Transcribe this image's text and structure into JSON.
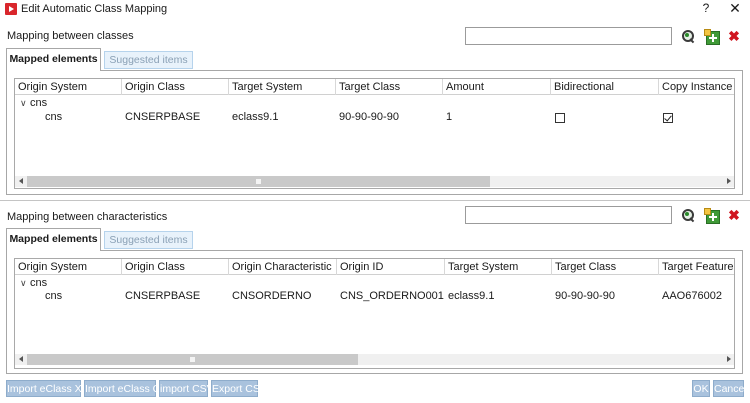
{
  "window": {
    "title": "Edit Automatic Class Mapping",
    "help_label": "?",
    "close_label": "✕"
  },
  "classes_section": {
    "label": "Mapping between classes",
    "search_value": "",
    "tabs": [
      {
        "label": "Mapped elements",
        "active": true
      },
      {
        "label": "Suggested items",
        "active": false
      }
    ],
    "columns": [
      "Origin System",
      "Origin Class",
      "Target System",
      "Target Class",
      "Amount",
      "Bidirectional",
      "Copy Instance"
    ],
    "group": {
      "label": "cns",
      "expanded": true
    },
    "rows": [
      {
        "origin_system": "cns",
        "origin_class": "CNSERPBASE",
        "target_system": "eclass9.1",
        "target_class": "90-90-90-90",
        "amount": "1",
        "bidirectional": false,
        "copy_instance": true
      }
    ]
  },
  "characteristics_section": {
    "label": "Mapping between characteristics",
    "search_value": "",
    "tabs": [
      {
        "label": "Mapped elements",
        "active": true
      },
      {
        "label": "Suggested items",
        "active": false
      }
    ],
    "columns": [
      "Origin System",
      "Origin Class",
      "Origin Characteristic",
      "Origin ID",
      "Target System",
      "Target Class",
      "Target Feature"
    ],
    "group": {
      "label": "cns",
      "expanded": true
    },
    "rows": [
      {
        "origin_system": "cns",
        "origin_class": "CNSERPBASE",
        "origin_characteristic": "CNSORDERNO",
        "origin_id": "CNS_ORDERNO001",
        "target_system": "eclass9.1",
        "target_class": "90-90-90-90",
        "target_feature": "AAO676002"
      }
    ]
  },
  "footer": {
    "buttons": [
      "Import eClass XML",
      "Import eClass CSV",
      "import CSV",
      "Export CSV"
    ],
    "ok_label": "OK",
    "cancel_label": "Cancel"
  },
  "icons": {
    "zoom": "zoom-select-icon",
    "add": "add-mapping-icon",
    "delete": "delete-icon",
    "app": "app-logo-icon"
  },
  "colors": {
    "delete": "#d0151f",
    "add": "#3f9a37",
    "button_disabled": "#a9c2dd",
    "tab_inactive": "#e8f2fb"
  }
}
